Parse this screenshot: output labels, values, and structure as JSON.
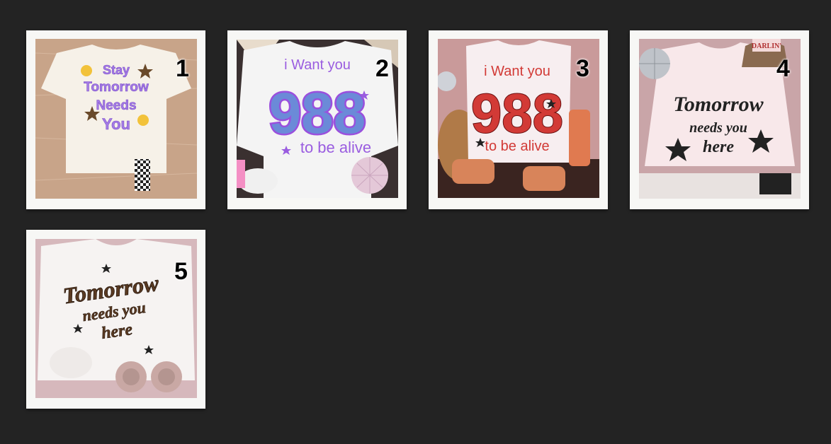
{
  "items": [
    {
      "number": "1",
      "design": [
        "Stay",
        "Tomorrow",
        "Needs",
        "You"
      ]
    },
    {
      "number": "2",
      "design": [
        "i Want you",
        "988",
        "to be alive"
      ]
    },
    {
      "number": "3",
      "design": [
        "i Want you",
        "988",
        "to be alive"
      ]
    },
    {
      "number": "4",
      "design": [
        "Tomorrow",
        "needs you",
        "here"
      ],
      "hat_text": "DARLIN'"
    },
    {
      "number": "5",
      "design": [
        "Tomorrow",
        "needs you",
        "here"
      ]
    }
  ],
  "colors": {
    "background": "#232323",
    "frame": "#f7f7f5",
    "purple": "#9a6ae0",
    "red": "#d23a36",
    "black_design": "#222222",
    "brown_design": "#5a3a22"
  }
}
